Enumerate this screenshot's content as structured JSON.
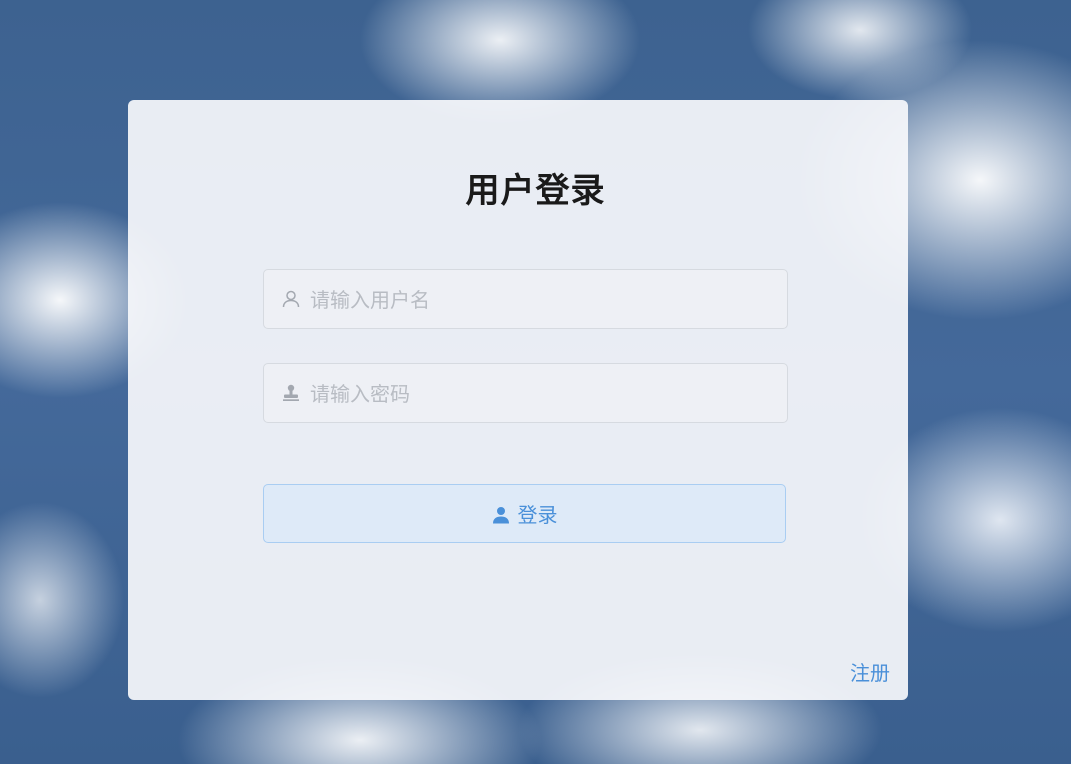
{
  "login_form": {
    "title": "用户登录",
    "username_placeholder": "请输入用户名",
    "username_value": "",
    "password_placeholder": "请输入密码",
    "password_value": "",
    "login_label": "登录",
    "register_label": "注册"
  },
  "icons": {
    "username": "user-outline-icon",
    "password": "stamp-icon",
    "login": "user-filled-icon"
  },
  "colors": {
    "accent": "#4a90d9",
    "button_bg": "#dce9f8",
    "button_border": "#a9cdf2",
    "title": "#1a1a1a",
    "placeholder": "#b8bcc3"
  }
}
